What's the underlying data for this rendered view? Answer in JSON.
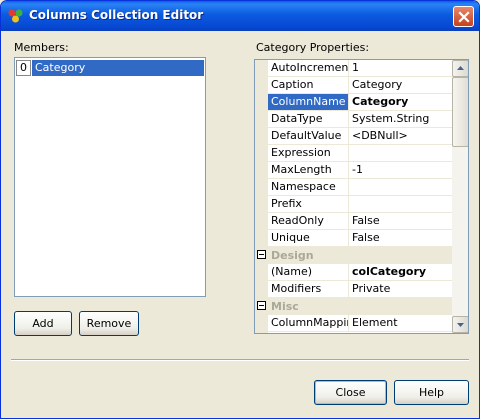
{
  "window": {
    "title": "Columns Collection Editor"
  },
  "members": {
    "label": "Members:",
    "items": [
      {
        "index": "0",
        "name": "Category"
      }
    ]
  },
  "buttons": {
    "add": "Add",
    "remove": "Remove",
    "close": "Close",
    "help": "Help"
  },
  "properties": {
    "label": "Category Properties:",
    "rows": [
      {
        "name": "AutoIncrement",
        "value": "1"
      },
      {
        "name": "Caption",
        "value": "Category"
      },
      {
        "name": "ColumnName",
        "value": "Category"
      },
      {
        "name": "DataType",
        "value": "System.String"
      },
      {
        "name": "DefaultValue",
        "value": "<DBNull>"
      },
      {
        "name": "Expression",
        "value": ""
      },
      {
        "name": "MaxLength",
        "value": "-1"
      },
      {
        "name": "Namespace",
        "value": ""
      },
      {
        "name": "Prefix",
        "value": ""
      },
      {
        "name": "ReadOnly",
        "value": "False"
      },
      {
        "name": "Unique",
        "value": "False"
      }
    ],
    "design_category": "Design",
    "design_rows": [
      {
        "name": "(Name)",
        "value": "colCategory"
      },
      {
        "name": "Modifiers",
        "value": "Private"
      }
    ],
    "misc_category": "Misc",
    "misc_rows": [
      {
        "name": "ColumnMappin",
        "value": "Element"
      }
    ]
  },
  "colors": {
    "selection": "#316ac5",
    "titlebar": "#0b5be0",
    "dialog_bg": "#ece9d8"
  }
}
